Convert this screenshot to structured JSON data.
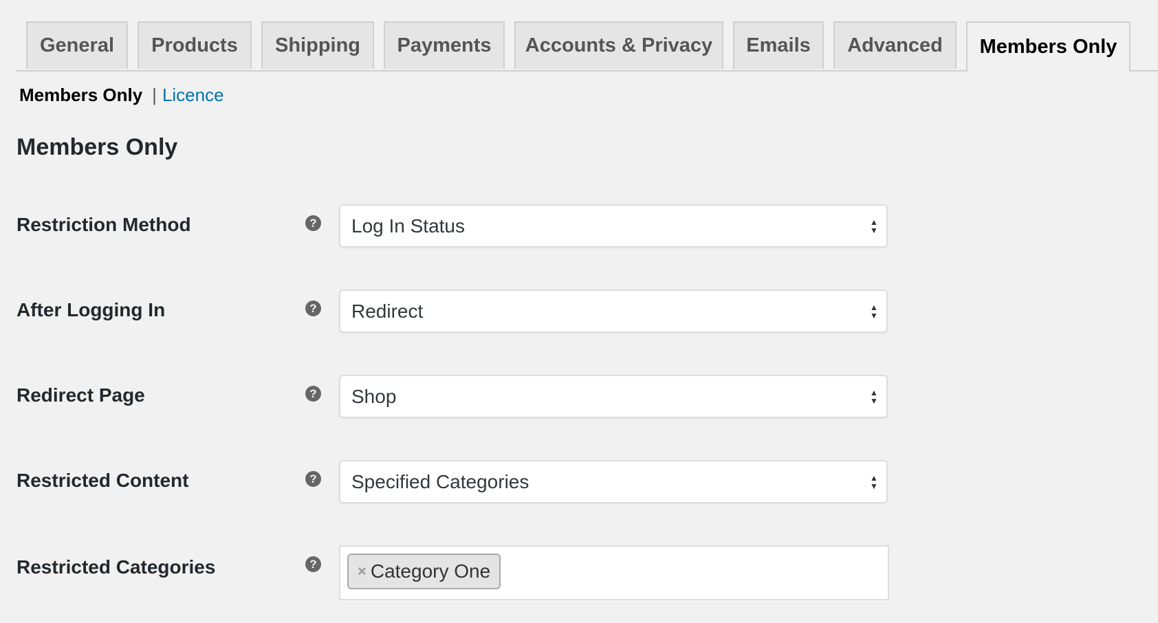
{
  "tabs": [
    {
      "label": "General",
      "active": false
    },
    {
      "label": "Products",
      "active": false
    },
    {
      "label": "Shipping",
      "active": false
    },
    {
      "label": "Payments",
      "active": false
    },
    {
      "label": "Accounts & Privacy",
      "active": false
    },
    {
      "label": "Emails",
      "active": false
    },
    {
      "label": "Advanced",
      "active": false
    },
    {
      "label": "Members Only",
      "active": true
    }
  ],
  "subnav": {
    "current": "Members Only",
    "separator": "|",
    "link": "Licence"
  },
  "section_title": "Members Only",
  "fields": [
    {
      "label": "Restriction Method",
      "help_icon": "question-circle-icon",
      "help_glyph": "?",
      "value": "Log In Status"
    },
    {
      "label": "After Logging In",
      "help_icon": "question-circle-icon",
      "help_glyph": "?",
      "value": "Redirect"
    },
    {
      "label": "Redirect Page",
      "help_icon": "question-circle-icon",
      "help_glyph": "?",
      "value": "Shop"
    },
    {
      "label": "Restricted Content",
      "help_icon": "question-circle-icon",
      "help_glyph": "?",
      "value": "Specified Categories"
    },
    {
      "label": "Restricted Categories",
      "help_icon": "question-circle-icon",
      "help_glyph": "?",
      "tags": [
        {
          "label": "Category One",
          "remove_glyph": "×"
        }
      ]
    }
  ],
  "select_arrows": {
    "up": "▲",
    "down": "▼"
  },
  "colors": {
    "background": "#f1f1f1",
    "link": "#0073aa",
    "tab_inactive_bg": "#e5e5e5",
    "tab_border": "#cfcfcf",
    "text": "#23282d"
  }
}
